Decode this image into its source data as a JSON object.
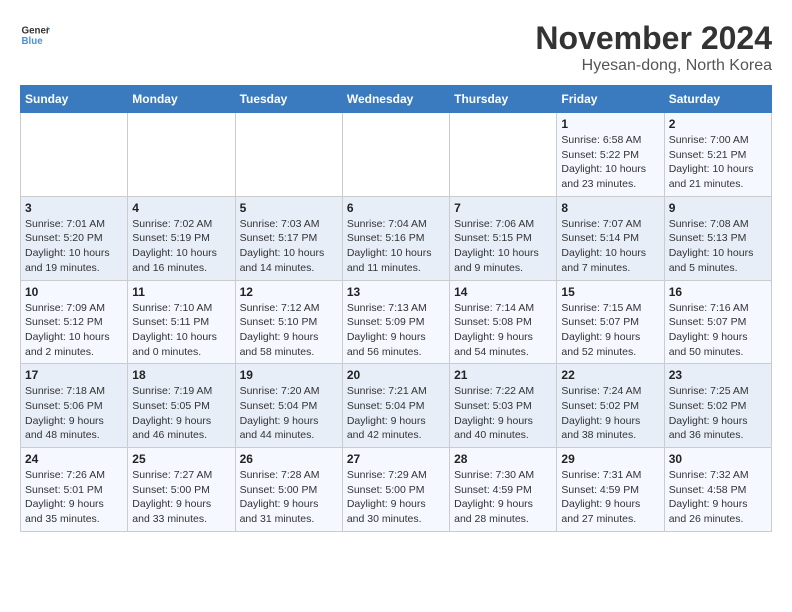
{
  "header": {
    "logo_line1": "General",
    "logo_line2": "Blue",
    "month": "November 2024",
    "location": "Hyesan-dong, North Korea"
  },
  "weekdays": [
    "Sunday",
    "Monday",
    "Tuesday",
    "Wednesday",
    "Thursday",
    "Friday",
    "Saturday"
  ],
  "weeks": [
    [
      {
        "day": "",
        "info": ""
      },
      {
        "day": "",
        "info": ""
      },
      {
        "day": "",
        "info": ""
      },
      {
        "day": "",
        "info": ""
      },
      {
        "day": "",
        "info": ""
      },
      {
        "day": "1",
        "info": "Sunrise: 6:58 AM\nSunset: 5:22 PM\nDaylight: 10 hours\nand 23 minutes."
      },
      {
        "day": "2",
        "info": "Sunrise: 7:00 AM\nSunset: 5:21 PM\nDaylight: 10 hours\nand 21 minutes."
      }
    ],
    [
      {
        "day": "3",
        "info": "Sunrise: 7:01 AM\nSunset: 5:20 PM\nDaylight: 10 hours\nand 19 minutes."
      },
      {
        "day": "4",
        "info": "Sunrise: 7:02 AM\nSunset: 5:19 PM\nDaylight: 10 hours\nand 16 minutes."
      },
      {
        "day": "5",
        "info": "Sunrise: 7:03 AM\nSunset: 5:17 PM\nDaylight: 10 hours\nand 14 minutes."
      },
      {
        "day": "6",
        "info": "Sunrise: 7:04 AM\nSunset: 5:16 PM\nDaylight: 10 hours\nand 11 minutes."
      },
      {
        "day": "7",
        "info": "Sunrise: 7:06 AM\nSunset: 5:15 PM\nDaylight: 10 hours\nand 9 minutes."
      },
      {
        "day": "8",
        "info": "Sunrise: 7:07 AM\nSunset: 5:14 PM\nDaylight: 10 hours\nand 7 minutes."
      },
      {
        "day": "9",
        "info": "Sunrise: 7:08 AM\nSunset: 5:13 PM\nDaylight: 10 hours\nand 5 minutes."
      }
    ],
    [
      {
        "day": "10",
        "info": "Sunrise: 7:09 AM\nSunset: 5:12 PM\nDaylight: 10 hours\nand 2 minutes."
      },
      {
        "day": "11",
        "info": "Sunrise: 7:10 AM\nSunset: 5:11 PM\nDaylight: 10 hours\nand 0 minutes."
      },
      {
        "day": "12",
        "info": "Sunrise: 7:12 AM\nSunset: 5:10 PM\nDaylight: 9 hours\nand 58 minutes."
      },
      {
        "day": "13",
        "info": "Sunrise: 7:13 AM\nSunset: 5:09 PM\nDaylight: 9 hours\nand 56 minutes."
      },
      {
        "day": "14",
        "info": "Sunrise: 7:14 AM\nSunset: 5:08 PM\nDaylight: 9 hours\nand 54 minutes."
      },
      {
        "day": "15",
        "info": "Sunrise: 7:15 AM\nSunset: 5:07 PM\nDaylight: 9 hours\nand 52 minutes."
      },
      {
        "day": "16",
        "info": "Sunrise: 7:16 AM\nSunset: 5:07 PM\nDaylight: 9 hours\nand 50 minutes."
      }
    ],
    [
      {
        "day": "17",
        "info": "Sunrise: 7:18 AM\nSunset: 5:06 PM\nDaylight: 9 hours\nand 48 minutes."
      },
      {
        "day": "18",
        "info": "Sunrise: 7:19 AM\nSunset: 5:05 PM\nDaylight: 9 hours\nand 46 minutes."
      },
      {
        "day": "19",
        "info": "Sunrise: 7:20 AM\nSunset: 5:04 PM\nDaylight: 9 hours\nand 44 minutes."
      },
      {
        "day": "20",
        "info": "Sunrise: 7:21 AM\nSunset: 5:04 PM\nDaylight: 9 hours\nand 42 minutes."
      },
      {
        "day": "21",
        "info": "Sunrise: 7:22 AM\nSunset: 5:03 PM\nDaylight: 9 hours\nand 40 minutes."
      },
      {
        "day": "22",
        "info": "Sunrise: 7:24 AM\nSunset: 5:02 PM\nDaylight: 9 hours\nand 38 minutes."
      },
      {
        "day": "23",
        "info": "Sunrise: 7:25 AM\nSunset: 5:02 PM\nDaylight: 9 hours\nand 36 minutes."
      }
    ],
    [
      {
        "day": "24",
        "info": "Sunrise: 7:26 AM\nSunset: 5:01 PM\nDaylight: 9 hours\nand 35 minutes."
      },
      {
        "day": "25",
        "info": "Sunrise: 7:27 AM\nSunset: 5:00 PM\nDaylight: 9 hours\nand 33 minutes."
      },
      {
        "day": "26",
        "info": "Sunrise: 7:28 AM\nSunset: 5:00 PM\nDaylight: 9 hours\nand 31 minutes."
      },
      {
        "day": "27",
        "info": "Sunrise: 7:29 AM\nSunset: 5:00 PM\nDaylight: 9 hours\nand 30 minutes."
      },
      {
        "day": "28",
        "info": "Sunrise: 7:30 AM\nSunset: 4:59 PM\nDaylight: 9 hours\nand 28 minutes."
      },
      {
        "day": "29",
        "info": "Sunrise: 7:31 AM\nSunset: 4:59 PM\nDaylight: 9 hours\nand 27 minutes."
      },
      {
        "day": "30",
        "info": "Sunrise: 7:32 AM\nSunset: 4:58 PM\nDaylight: 9 hours\nand 26 minutes."
      }
    ]
  ]
}
